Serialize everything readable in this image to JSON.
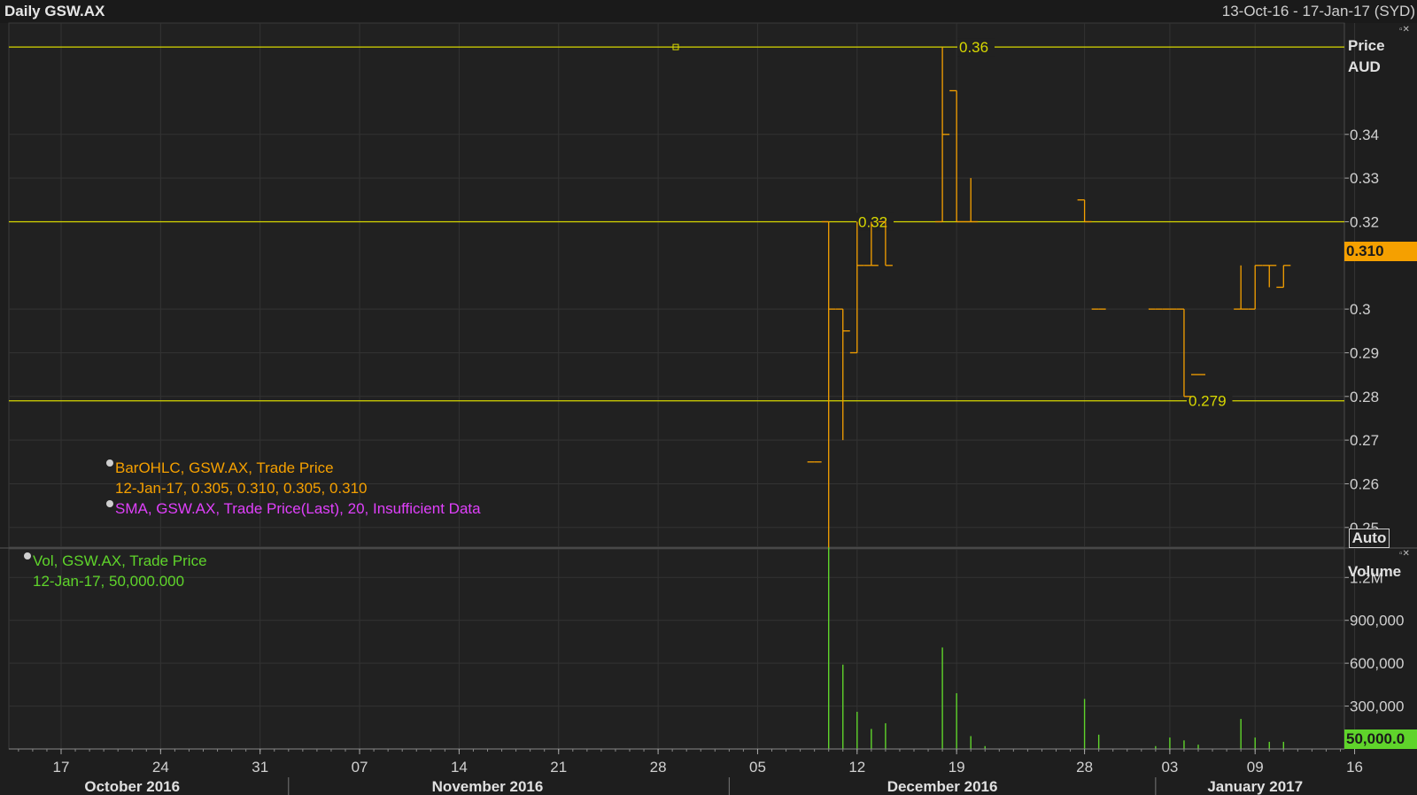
{
  "header": {
    "title": "Daily GSW.AX",
    "range": "13-Oct-16 - 17-Jan-17 (SYD)"
  },
  "price_axis": {
    "title_line1": "Price",
    "title_line2": "AUD",
    "auto_label": "Auto"
  },
  "volume_axis": {
    "title": "Volume"
  },
  "last_price_tag": "0.310",
  "last_volume_tag": "50,000.0",
  "legend": {
    "bar_line1": "BarOHLC, GSW.AX, Trade Price",
    "bar_line2": "12-Jan-17, 0.305, 0.310, 0.305, 0.310",
    "sma_line": "SMA, GSW.AX, Trade Price(Last),  20,  Insufficient Data",
    "vol_line1": "Vol, GSW.AX, Trade Price",
    "vol_line2": "12-Jan-17, 50,000.000"
  },
  "colors": {
    "bars": "#f5a000",
    "volume": "#5fd42b",
    "hlines": "#d8d800",
    "sma": "#e040fb",
    "grid": "#333333"
  },
  "chart_data": [
    {
      "type": "bar",
      "subtype": "ohlc",
      "ylabel": "Price AUD",
      "ylim": [
        0.2455,
        0.3655
      ],
      "y_ticks": [
        {
          "v": 0.25,
          "label": "0.25"
        },
        {
          "v": 0.26,
          "label": "0.26"
        },
        {
          "v": 0.27,
          "label": "0.27"
        },
        {
          "v": 0.28,
          "label": "0.28"
        },
        {
          "v": 0.29,
          "label": "0.29"
        },
        {
          "v": 0.3,
          "label": "0.3"
        },
        {
          "v": 0.32,
          "label": "0.32"
        },
        {
          "v": 0.33,
          "label": "0.33"
        },
        {
          "v": 0.34,
          "label": "0.34"
        }
      ],
      "horizontal_lines": [
        {
          "value": 0.36,
          "label": "0.36"
        },
        {
          "value": 0.32,
          "label": "0.32"
        },
        {
          "value": 0.279,
          "label": "0.279"
        }
      ],
      "ohlc": [
        {
          "date": "2016-12-09",
          "o": 0.265,
          "h": 0.265,
          "l": 0.265,
          "c": 0.265
        },
        {
          "date": "2016-12-10",
          "o": 0.32,
          "h": 0.32,
          "l": 0.245,
          "c": 0.3
        },
        {
          "date": "2016-12-11",
          "o": 0.3,
          "h": 0.3,
          "l": 0.27,
          "c": 0.295
        },
        {
          "date": "2016-12-12",
          "o": 0.29,
          "h": 0.32,
          "l": 0.29,
          "c": 0.31
        },
        {
          "date": "2016-12-13",
          "o": 0.31,
          "h": 0.32,
          "l": 0.31,
          "c": 0.31
        },
        {
          "date": "2016-12-14",
          "o": 0.32,
          "h": 0.32,
          "l": 0.31,
          "c": 0.31
        },
        {
          "date": "2016-12-18",
          "o": 0.32,
          "h": 0.36,
          "l": 0.32,
          "c": 0.34
        },
        {
          "date": "2016-12-19",
          "o": 0.35,
          "h": 0.35,
          "l": 0.32,
          "c": 0.32
        },
        {
          "date": "2016-12-20",
          "o": 0.32,
          "h": 0.33,
          "l": 0.32,
          "c": 0.32
        },
        {
          "date": "2016-12-28",
          "o": 0.325,
          "h": 0.325,
          "l": 0.32,
          "c": 0.32
        },
        {
          "date": "2016-12-29",
          "o": 0.3,
          "h": 0.3,
          "l": 0.3,
          "c": 0.3
        },
        {
          "date": "2017-01-02",
          "o": 0.3,
          "h": 0.3,
          "l": 0.3,
          "c": 0.3
        },
        {
          "date": "2017-01-03",
          "o": 0.3,
          "h": 0.3,
          "l": 0.3,
          "c": 0.3
        },
        {
          "date": "2017-01-04",
          "o": 0.3,
          "h": 0.3,
          "l": 0.28,
          "c": 0.28
        },
        {
          "date": "2017-01-05",
          "o": 0.285,
          "h": 0.285,
          "l": 0.285,
          "c": 0.285
        },
        {
          "date": "2017-01-08",
          "o": 0.3,
          "h": 0.31,
          "l": 0.3,
          "c": 0.3
        },
        {
          "date": "2017-01-09",
          "o": 0.3,
          "h": 0.31,
          "l": 0.3,
          "c": 0.31
        },
        {
          "date": "2017-01-10",
          "o": 0.31,
          "h": 0.31,
          "l": 0.305,
          "c": 0.31
        },
        {
          "date": "2017-01-11",
          "o": 0.305,
          "h": 0.31,
          "l": 0.305,
          "c": 0.31
        }
      ]
    },
    {
      "type": "bar",
      "ylabel": "Volume",
      "ylim": [
        0,
        1400000
      ],
      "y_ticks": [
        {
          "v": 300000,
          "label": "300,000"
        },
        {
          "v": 600000,
          "label": "600,000"
        },
        {
          "v": 900000,
          "label": "900,000"
        },
        {
          "v": 1200000,
          "label": "1.2M"
        }
      ],
      "x": [
        "2016-12-10",
        "2016-12-11",
        "2016-12-12",
        "2016-12-13",
        "2016-12-14",
        "2016-12-18",
        "2016-12-19",
        "2016-12-20",
        "2016-12-21",
        "2016-12-28",
        "2016-12-29",
        "2017-01-02",
        "2017-01-03",
        "2017-01-04",
        "2017-01-05",
        "2017-01-08",
        "2017-01-09",
        "2017-01-10",
        "2017-01-11"
      ],
      "values": [
        1410000,
        590000,
        260000,
        140000,
        180000,
        710000,
        390000,
        90000,
        20000,
        350000,
        100000,
        20000,
        80000,
        60000,
        30000,
        210000,
        80000,
        50000,
        50000
      ]
    }
  ],
  "x_axis": {
    "ticks": [
      {
        "date": "2016-10-17",
        "label": "17"
      },
      {
        "date": "2016-10-24",
        "label": "24"
      },
      {
        "date": "2016-10-31",
        "label": "31"
      },
      {
        "date": "2016-11-07",
        "label": "07"
      },
      {
        "date": "2016-11-14",
        "label": "14"
      },
      {
        "date": "2016-11-21",
        "label": "21"
      },
      {
        "date": "2016-11-28",
        "label": "28"
      },
      {
        "date": "2016-12-05",
        "label": "05"
      },
      {
        "date": "2016-12-12",
        "label": "12"
      },
      {
        "date": "2016-12-19",
        "label": "19"
      },
      {
        "date": "2016-12-28",
        "label": "28"
      },
      {
        "date": "2017-01-03",
        "label": "03"
      },
      {
        "date": "2017-01-09",
        "label": "09"
      },
      {
        "date": "2017-01-16",
        "label": "16"
      }
    ],
    "months": [
      {
        "center": "2016-10-22",
        "label": "October 2016"
      },
      {
        "center": "2016-11-16",
        "label": "November 2016"
      },
      {
        "center": "2016-12-18",
        "label": "December 2016"
      },
      {
        "center": "2017-01-09",
        "label": "January 2017"
      }
    ],
    "month_separators": [
      "2016-11-02",
      "2016-12-03",
      "2017-01-02"
    ]
  }
}
